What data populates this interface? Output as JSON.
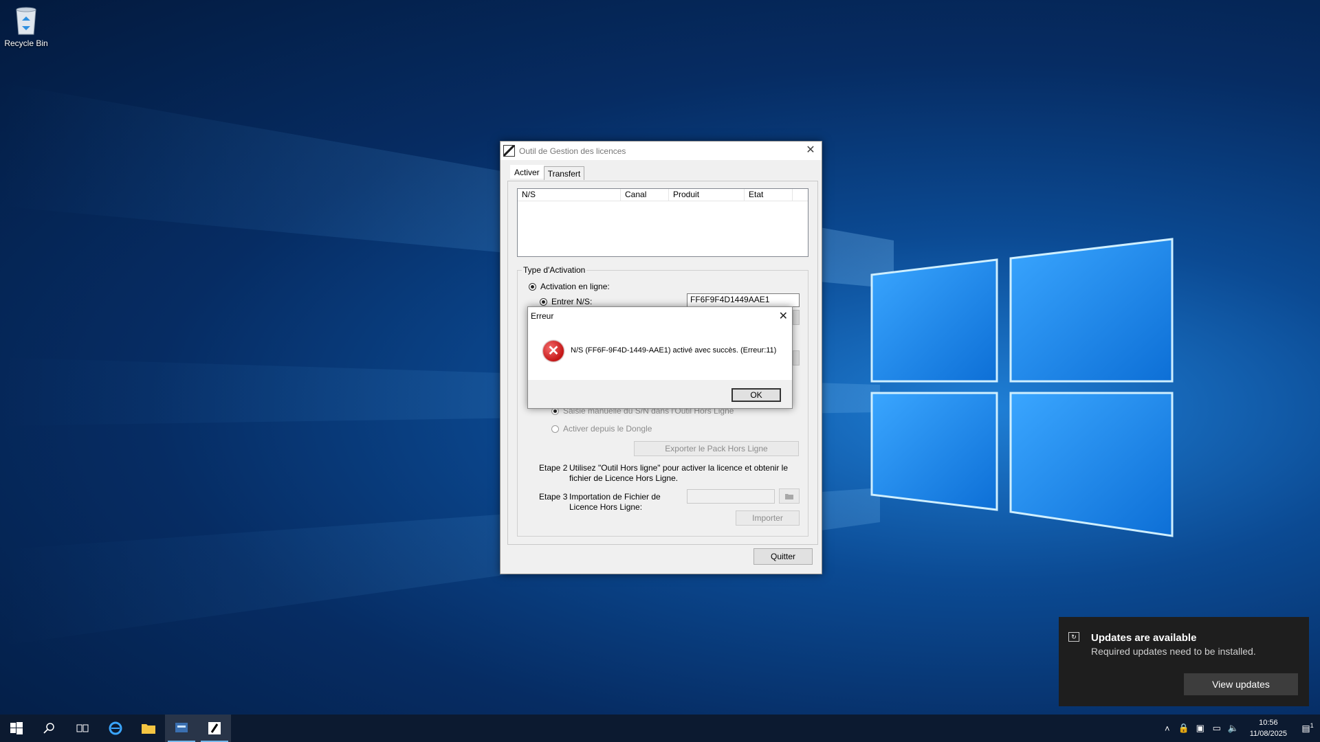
{
  "desktop": {
    "recycle_bin_label": "Recycle Bin"
  },
  "main_window": {
    "title": "Outil de Gestion des licences",
    "tabs": [
      {
        "label": "Activer"
      },
      {
        "label": "Transfert"
      }
    ],
    "list_columns": [
      "N/S",
      "Canal",
      "Produit",
      "Etat"
    ],
    "group_label": "Type d'Activation",
    "online_activation": "Activation en ligne:",
    "enter_sn": "Entrer N/S:",
    "sn_value": "FF6F9F4D1449AAE1",
    "manual_entry": "Saisie manuelle du  S/N dans l'Outil Hors Ligne",
    "dongle": "Activer depuis le Dongle",
    "export_button": "Exporter le Pack Hors Ligne",
    "step2_label": "Etape 2",
    "step2_text": "Utilisez \"Outil Hors ligne\" pour activer la licence et obtenir le fichier de Licence Hors Ligne.",
    "step3_label": "Etape 3",
    "step3_text": "Importation de Fichier de Licence Hors Ligne:",
    "import_button": "Importer",
    "quit_button": "Quitter"
  },
  "error_dialog": {
    "title": "Erreur",
    "message": "N/S (FF6F-9F4D-1449-AAE1) activé avec succès. (Erreur:11)",
    "ok_button": "OK"
  },
  "taskbar": {
    "icons": [
      "windows-start-icon",
      "search-icon",
      "task-view-icon",
      "internet-explorer-icon",
      "file-explorer-icon",
      "server-manager-icon",
      "license-tool-icon"
    ],
    "time": "10:56",
    "date": "11/08/2025",
    "notification_count": "1"
  },
  "toast": {
    "title": "Updates are available",
    "message": "Required updates need to be installed.",
    "button": "View updates"
  },
  "colors": {
    "accent": "#76b9ed",
    "desktop_blue": "#0b4a93",
    "error_red": "#c41515"
  }
}
